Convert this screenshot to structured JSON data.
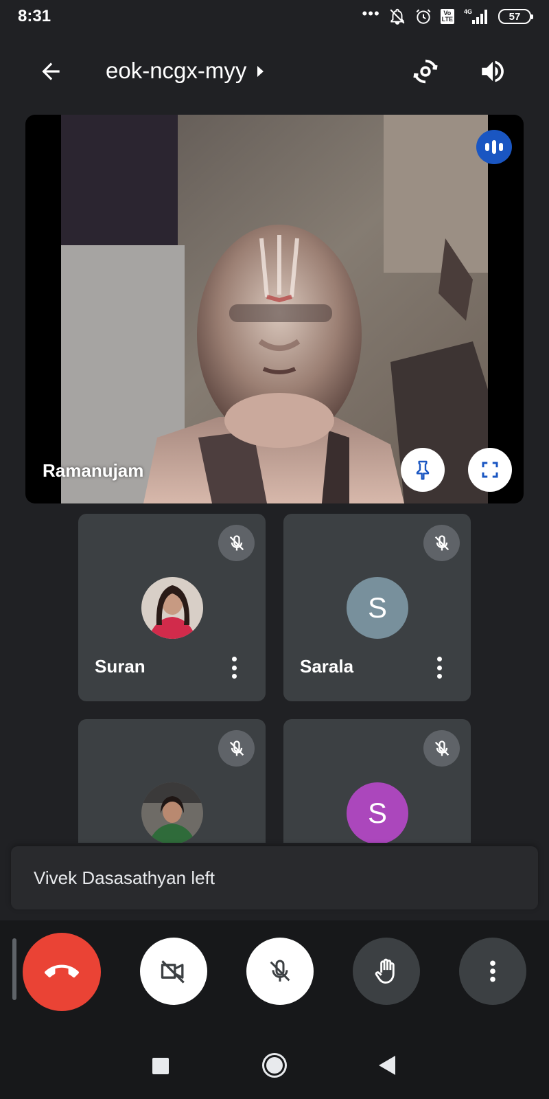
{
  "status_bar": {
    "time": "8:31",
    "more_dots": "•••",
    "volte": "Vo\nLTE",
    "network": "4G",
    "battery": "57"
  },
  "header": {
    "meeting_code": "eok-ncgx-myy",
    "icons": [
      "back-arrow-icon",
      "switch-camera-icon",
      "speaker-icon"
    ]
  },
  "main_speaker": {
    "name": "Ramanujam",
    "speaking": true
  },
  "participants": [
    {
      "name": "Suran",
      "avatar_type": "photo",
      "muted": true
    },
    {
      "name": "Sarala",
      "avatar_type": "initial",
      "initial": "S",
      "avatar_color": "#78909c",
      "muted": true
    },
    {
      "name": "",
      "avatar_type": "photo",
      "muted": true
    },
    {
      "name": "",
      "avatar_type": "initial",
      "initial": "S",
      "avatar_color": "#ab47bc",
      "muted": true
    }
  ],
  "toast": {
    "message": "Vivek Dasasathyan left"
  },
  "controls": {
    "end_call_color": "#ea4335",
    "camera_off": true,
    "mic_off": true
  },
  "colors": {
    "background": "#202124",
    "tile": "#3c4043",
    "accent_blue": "#1a56c2"
  }
}
